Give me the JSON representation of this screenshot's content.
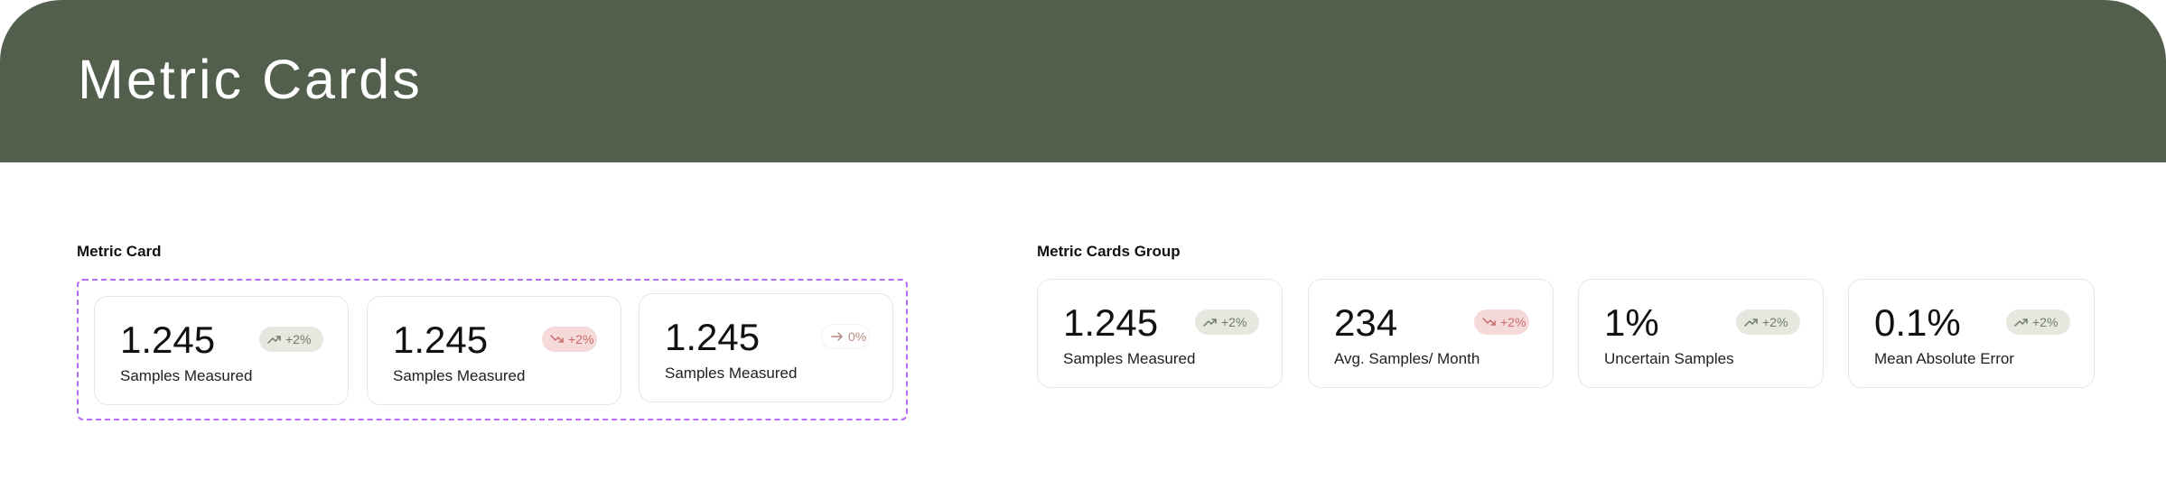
{
  "header": {
    "title": "Metric Cards"
  },
  "metric_card_section": {
    "label": "Metric Card",
    "cards": [
      {
        "value": "1.245",
        "label": "Samples Measured",
        "badge": {
          "text": "+2%",
          "trend": "up",
          "icon": "trend-up-icon",
          "background": "#e6e8e0",
          "color": "#6f7b68"
        }
      },
      {
        "value": "1.245",
        "label": "Samples Measured",
        "badge": {
          "text": "+2%",
          "trend": "down",
          "icon": "trend-down-icon",
          "background": "#f6dada",
          "color": "#c76c6c"
        }
      },
      {
        "value": "1.245",
        "label": "Samples Measured",
        "badge": {
          "text": "0%",
          "trend": "neutral",
          "icon": "arrow-right-icon",
          "background": "#ffffff",
          "color": "#b48b7e"
        }
      }
    ]
  },
  "metric_cards_group_section": {
    "label": "Metric Cards Group",
    "cards": [
      {
        "value": "1.245",
        "label": "Samples Measured",
        "badge": {
          "text": "+2%",
          "trend": "up",
          "icon": "trend-up-icon"
        }
      },
      {
        "value": "234",
        "label": "Avg. Samples/ Month",
        "badge": {
          "text": "+2%",
          "trend": "down",
          "icon": "trend-down-icon"
        }
      },
      {
        "value": "1%",
        "label": "Uncertain Samples",
        "badge": {
          "text": "+2%",
          "trend": "up",
          "icon": "trend-up-icon"
        }
      },
      {
        "value": "0.1%",
        "label": "Mean Absolute Error",
        "badge": {
          "text": "+2%",
          "trend": "up",
          "icon": "trend-up-icon"
        }
      }
    ]
  },
  "colors": {
    "header_background": "#535f4d",
    "selection_outline": "#b66cf4",
    "card_border": "#e7e7e7"
  }
}
